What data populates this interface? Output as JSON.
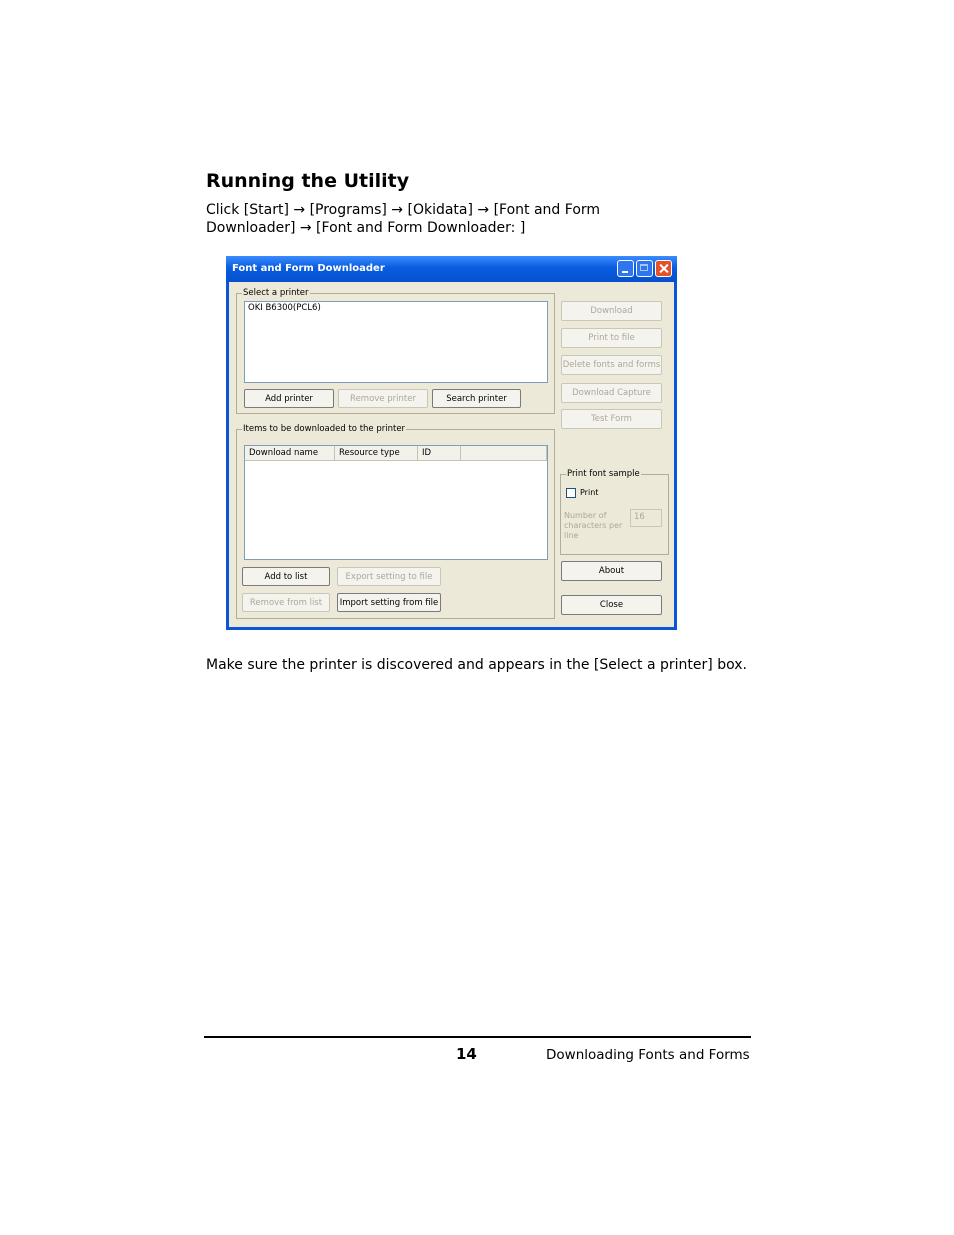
{
  "doc": {
    "heading": "Running the Utility",
    "instruction": "Click [Start] → [Programs] → [Okidata] → [Font and Form Downloader] → [Font and Form Downloader: ]",
    "note": "Make sure the printer is discovered and appears in the [Select a printer] box.",
    "page_number": "14",
    "footer_title": "Downloading Fonts and Forms"
  },
  "window": {
    "title": "Font and Form Downloader",
    "select_printer": {
      "label": "Select a printer",
      "items": [
        "OKI B6300(PCL6)"
      ],
      "add_printer": "Add printer",
      "remove_printer": "Remove printer",
      "search_printer": "Search printer"
    },
    "items_group": {
      "label": "Items to be downloaded to the printer",
      "columns": [
        "Download name",
        "Resource type",
        "ID"
      ],
      "add_to_list": "Add to list",
      "export_setting": "Export setting to file",
      "remove_from_list": "Remove from list",
      "import_setting": "Import setting from file"
    },
    "side_buttons": {
      "download": "Download",
      "print_to_file": "Print to file",
      "delete_fonts": "Delete fonts and forms",
      "download_capture": "Download Capture",
      "test_form": "Test Form",
      "about": "About",
      "close": "Close"
    },
    "print_font_sample": {
      "label": "Print font sample",
      "print_checkbox": "Print",
      "chars_label": "Number of characters per line",
      "chars_value": "16"
    }
  }
}
